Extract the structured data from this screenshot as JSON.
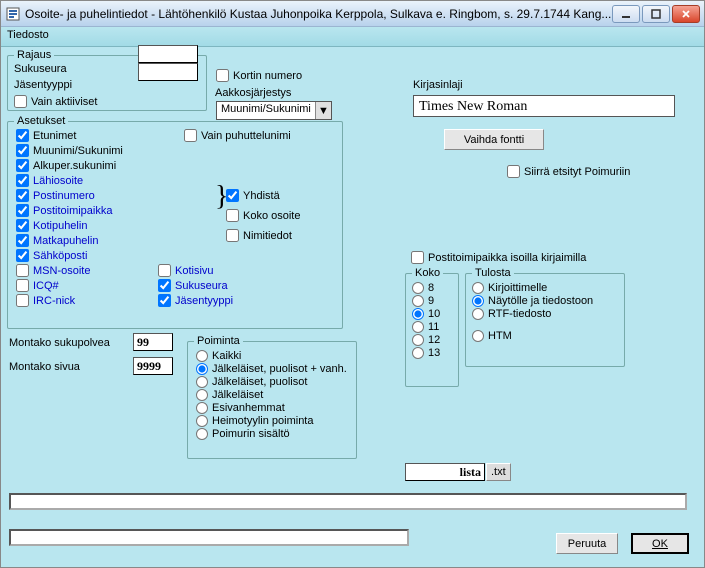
{
  "window": {
    "title": "Osoite- ja puhelintiedot - Lähtöhenkilö Kustaa Juhonpoika Kerppola, Sulkava e. Ringbom,  s. 29.7.1744 Kang...",
    "icon": "form-icon"
  },
  "menu": {
    "file": "Tiedosto"
  },
  "rajaus": {
    "legend": "Rajaus",
    "sukuseura": "Sukuseura",
    "jasentyyppi": "Jäsentyyppi",
    "vain_aktiiviset": "Vain aktiiviset"
  },
  "asetukset": {
    "legend": "Asetukset",
    "items": {
      "etunimet": "Etunimet",
      "muunimi": "Muunimi/Sukunimi",
      "alkuper": "Alkuper.sukunimi",
      "lahiosoite": "Lähiosoite",
      "postinumero": "Postinumero",
      "postitoimipaikka": "Postitoimipaikka",
      "kotipuhelin": "Kotipuhelin",
      "matkapuhelin": "Matkapuhelin",
      "sahkoposti": "Sähköposti",
      "msn": "MSN-osoite",
      "icq": "ICQ#",
      "irc": "IRC-nick",
      "kotisivu": "Kotisivu",
      "sukuseura": "Sukuseura",
      "jasentyyppi": "Jäsentyyppi"
    },
    "vain_puhuttelunimi": "Vain puhuttelunimi",
    "yhdista": "Yhdistä",
    "koko_osoite": "Koko osoite",
    "nimitiedot": "Nimitiedot"
  },
  "kortin_numero": "Kortin numero",
  "aakkos": {
    "label": "Aakkosjärjestys",
    "value": "Muunimi/Sukunimi"
  },
  "counts": {
    "polvea_label": "Montako sukupolvea",
    "polvea_value": "99",
    "sivua_label": "Montako sivua",
    "sivua_value": "9999"
  },
  "poiminta": {
    "legend": "Poiminta",
    "options": [
      "Kaikki",
      "Jälkeläiset, puolisot + vanh.",
      "Jälkeläiset, puolisot",
      "Jälkeläiset",
      "Esivanhemmat",
      "Heimotyylin poiminta",
      "Poimurin sisältö"
    ],
    "selected": 1
  },
  "kirjasinlaji": {
    "label": "Kirjasinlaji",
    "value": "Times New Roman",
    "button": "Vaihda fontti"
  },
  "siirra": "Siirrä etsityt Poimuriin",
  "postitoimi_iso": "Postitoimipaikka isoilla kirjaimilla",
  "koko": {
    "legend": "Koko",
    "options": [
      "8",
      "9",
      "10",
      "11",
      "12",
      "13"
    ],
    "selected": 2
  },
  "tulosta": {
    "legend": "Tulosta",
    "options": [
      "Kirjoittimelle",
      "Näytölle ja tiedostoon",
      "RTF-tiedosto",
      "HTM"
    ],
    "selected": 1
  },
  "file": {
    "name": "lista",
    "ext": ".txt"
  },
  "buttons": {
    "cancel": "Peruuta",
    "ok": "OK"
  }
}
